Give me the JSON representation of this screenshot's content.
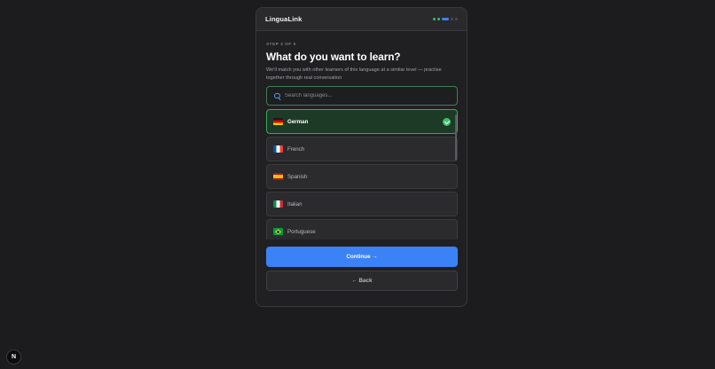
{
  "header": {
    "brand": "LinguaLink",
    "progress": {
      "completed_steps": 2,
      "current_step": 3,
      "total_steps": 5
    }
  },
  "main": {
    "step_label": "STEP 3 OF 5",
    "title": "What do you want to learn?",
    "subtitle": "We'll match you with other learners of this language at a similar level — practise together through real conversation"
  },
  "search": {
    "placeholder": "Search languages..."
  },
  "languages": [
    {
      "name": "German",
      "flag": "de",
      "selected": true
    },
    {
      "name": "French",
      "flag": "fr",
      "selected": false
    },
    {
      "name": "Spanish",
      "flag": "es",
      "selected": false
    },
    {
      "name": "Italian",
      "flag": "it",
      "selected": false
    },
    {
      "name": "Portuguese",
      "flag": "br",
      "selected": false
    }
  ],
  "actions": {
    "continue_label": "Continue →",
    "back_label": "← Back"
  },
  "fab": {
    "label": "N"
  },
  "colors": {
    "accent": "#3b82f6",
    "success": "#3ec16a",
    "background": "#1c1c1e"
  }
}
